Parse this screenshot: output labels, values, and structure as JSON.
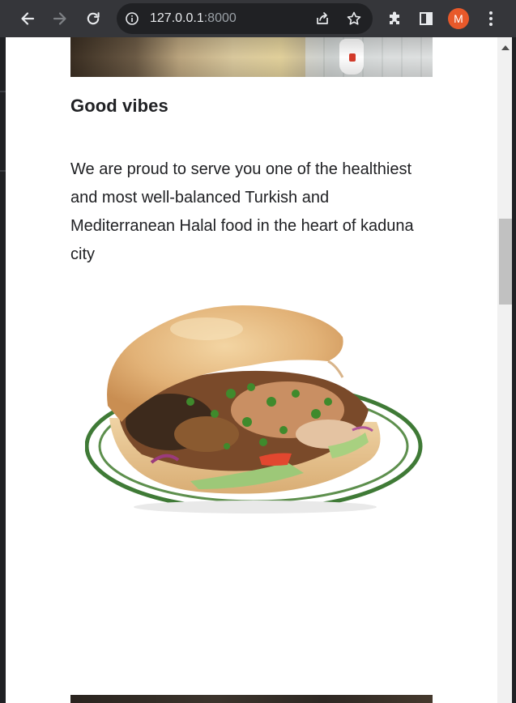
{
  "browser": {
    "url_host": "127.0.0.1",
    "url_port": ":8000",
    "avatar_initial": "M",
    "icons": {
      "back": "arrow-left-icon",
      "forward": "arrow-right-icon",
      "reload": "reload-icon",
      "site_info": "info-icon",
      "share": "share-icon",
      "bookmark": "star-icon",
      "extensions": "puzzle-icon",
      "side_panel": "side-panel-icon",
      "menu": "kebab-menu-icon"
    },
    "colors": {
      "toolbar": "#35363a",
      "avatar": "#e8592a"
    }
  },
  "page": {
    "heading": "Good vibes",
    "paragraph": "We are proud to serve you one of the healthiest and most well-balanced Turkish and Mediterranean Halal food in the heart of kaduna city",
    "images": [
      "food-hero-top-image",
      "doner-sandwich-image",
      "food-hero-bottom-image"
    ]
  }
}
